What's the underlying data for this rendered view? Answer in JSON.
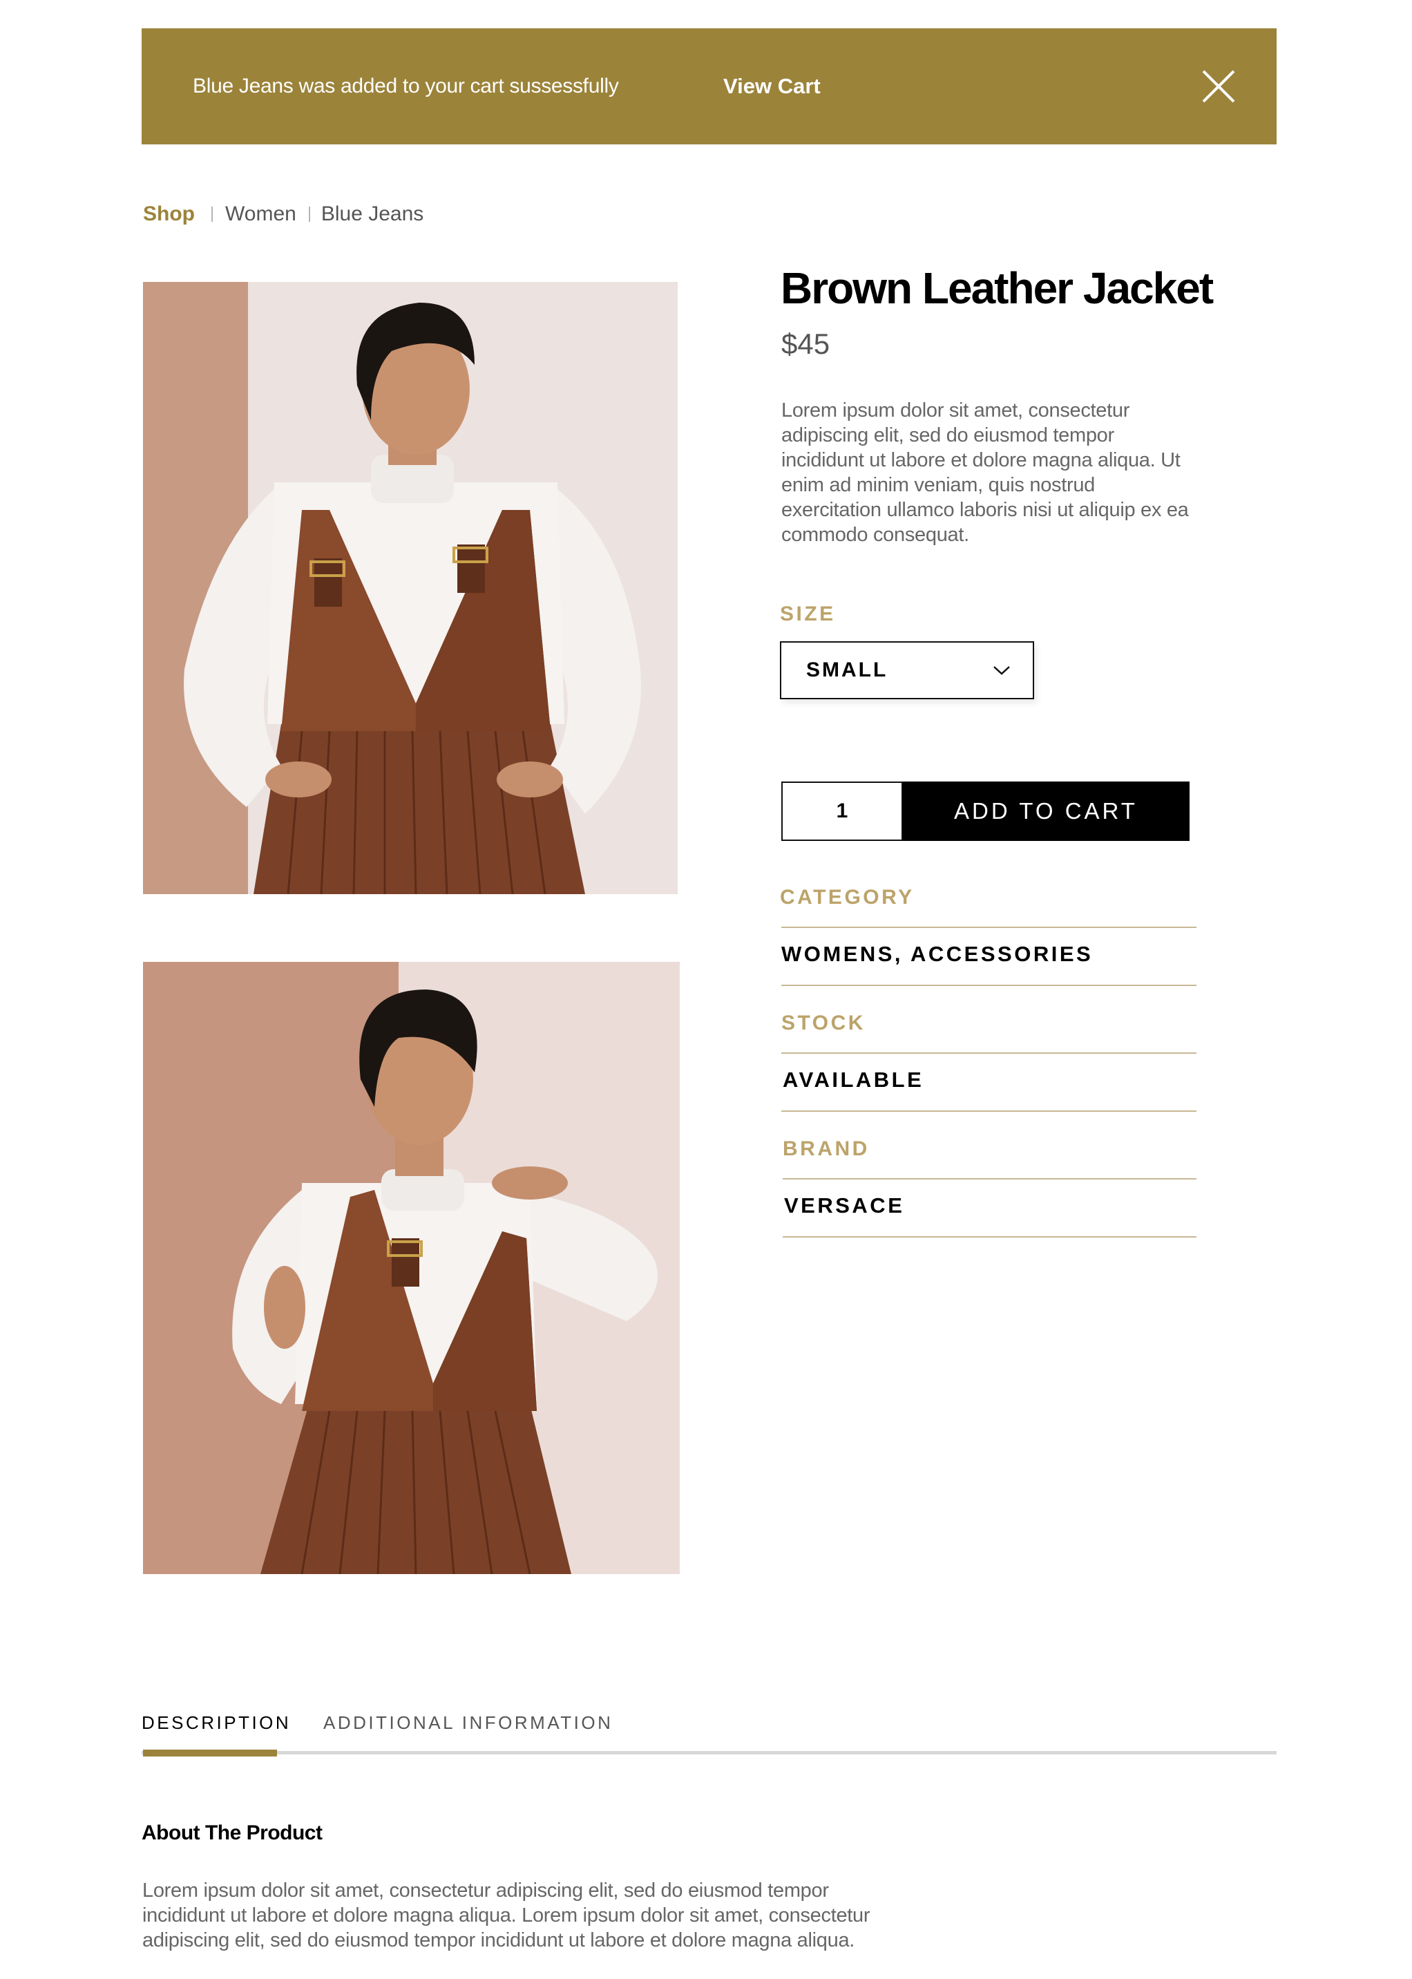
{
  "notification": {
    "message": "Blue Jeans was added to your cart sussessfully",
    "link_label": "View Cart",
    "close_icon": "close-icon",
    "background_color": "#9b833a"
  },
  "breadcrumb": {
    "items": [
      "Shop",
      "Women",
      "Blue Jeans"
    ]
  },
  "product": {
    "title": "Brown Leather Jacket",
    "price": "$45",
    "description": "Lorem ipsum dolor sit amet, consectetur adipiscing elit, sed do eiusmod tempor incididunt ut labore et dolore magna aliqua. Ut enim ad minim veniam, quis nostrud exercitation ullamco laboris nisi ut aliquip ex ea commodo consequat.",
    "images": [
      {
        "icon": "product-photo"
      },
      {
        "icon": "product-photo"
      }
    ]
  },
  "size": {
    "label": "SIZE",
    "selected": "SMALL",
    "icon": "chevron-down-icon"
  },
  "purchase": {
    "quantity": "1",
    "add_to_cart_label": "ADD TO CART"
  },
  "meta": {
    "category_label": "CATEGORY",
    "category_value": "WOMENS, ACCESSORIES",
    "stock_label": "STOCK",
    "stock_value": "AVAILABLE",
    "brand_label": "BRAND",
    "brand_value": "VERSACE"
  },
  "tabs": {
    "items": [
      {
        "label": "DESCRIPTION",
        "active": true
      },
      {
        "label": "ADDITIONAL INFORMATION",
        "active": false
      }
    ]
  },
  "about": {
    "title": "About The Product",
    "text": "Lorem ipsum dolor sit amet, consectetur adipiscing elit, sed do eiusmod tempor incididunt ut labore et dolore magna aliqua. Lorem ipsum dolor sit amet, consectetur adipiscing elit, sed do eiusmod tempor incididunt ut labore et dolore magna aliqua."
  },
  "colors": {
    "accent": "#9b833a",
    "label_gold": "#bca36a",
    "divider": "#c8b894",
    "button": "#000000"
  }
}
